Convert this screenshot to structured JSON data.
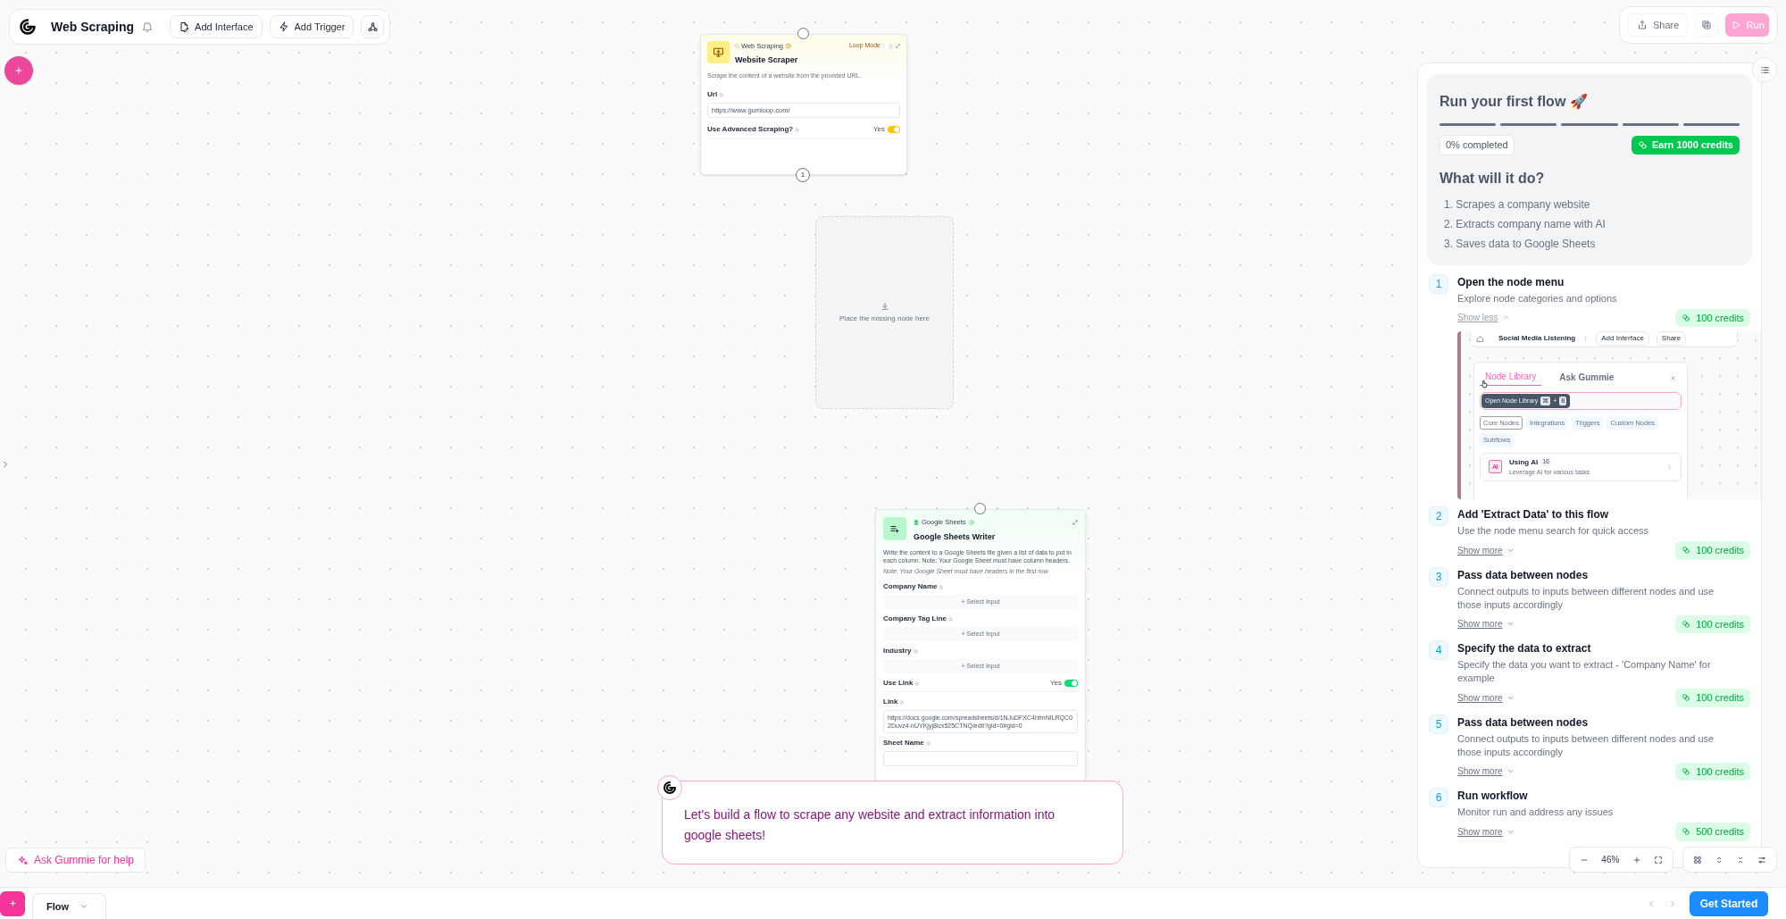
{
  "toolbar": {
    "title": "Web Scraping",
    "buttons": [
      {
        "kind": "interface",
        "label": "Add Interface"
      },
      {
        "kind": "trigger",
        "label": "Add Trigger"
      }
    ]
  },
  "scraper_node": {
    "category": "Web Scraping",
    "title": "Website Scraper",
    "loop_mode": {
      "label": "Loop Mode",
      "on": false
    },
    "description": "Scrape the content of a website from the provided URL.",
    "fields": [
      {
        "kind": "text",
        "label": "Url",
        "value": "https://www.gumloop.com/"
      },
      {
        "kind": "toggle",
        "label": "Use Advanced Scraping?",
        "value_label": "Yes",
        "on": true
      }
    ],
    "output_count": "1"
  },
  "placeholder": {
    "label": "Place the missing node here"
  },
  "sheets_node": {
    "category": "Google Sheets",
    "title": "Google Sheets Writer",
    "description": "Write the content to a Google Sheets file given a list of data to put in each column. Note: Your Google Sheet must have column headers.",
    "note": "Note: Your Google Sheet must have headers in the first row",
    "fields": [
      {
        "kind": "select",
        "label": "Company Name",
        "placeholder": "+ Select Input"
      },
      {
        "kind": "select",
        "label": "Company Tag Line",
        "placeholder": "+ Select Input"
      },
      {
        "kind": "select",
        "label": "Industry",
        "placeholder": "+ Select Input"
      },
      {
        "kind": "toggle",
        "label": "Use Link",
        "value_label": "Yes",
        "on": true
      },
      {
        "kind": "textarea",
        "label": "Link",
        "value": "https://docs.google.com/spreadsheets/d/1NJuDFXC4hfmNILRQC02Duvz4-nUYKjyj8icx525CTNQ/edit?gid=0#gid=0"
      },
      {
        "kind": "text",
        "label": "Sheet Name"
      }
    ]
  },
  "chat_bubble": {
    "message": "Let's build a flow to scrape any website and extract information into google sheets!"
  },
  "help_button": {
    "label": "Ask Gummie for help"
  },
  "top_actions": {
    "share": "Share",
    "run": {
      "label": "Run",
      "disabled": true
    }
  },
  "guide": {
    "title": "Run your first flow 🚀",
    "progress_segments": [
      {
        "done": false
      },
      {
        "done": false
      },
      {
        "done": false
      },
      {
        "done": false
      },
      {
        "done": false
      }
    ],
    "completed": "0% completed",
    "earn": "Earn 1000 credits",
    "subtitle": "What will it do?",
    "items": [
      "1. Scrapes a company website",
      "2. Extracts company name with AI",
      "3. Saves data to Google Sheets"
    ],
    "steps": [
      {
        "number": "1",
        "title": "Open the node menu",
        "description": "Explore node categories and options",
        "toggle": "Show less",
        "expanded": true,
        "credits": "100 credits"
      },
      {
        "number": "2",
        "title": "Add 'Extract Data' to this flow",
        "description": "Use the node menu search for quick access",
        "toggle": "Show more",
        "expanded": false,
        "credits": "100 credits"
      },
      {
        "number": "3",
        "title": "Pass data between nodes",
        "description": "Connect outputs to inputs between different nodes and use those inputs accordingly",
        "toggle": "Show more",
        "expanded": false,
        "credits": "100 credits"
      },
      {
        "number": "4",
        "title": "Specify the data to extract",
        "description": "Specify the data you want to extract - 'Company Name' for example",
        "toggle": "Show more",
        "expanded": false,
        "credits": "100 credits"
      },
      {
        "number": "5",
        "title": "Pass data between nodes",
        "description": "Connect outputs to inputs between different nodes and use those inputs accordingly",
        "toggle": "Show more",
        "expanded": false,
        "credits": "100 credits"
      },
      {
        "number": "6",
        "title": "Run workflow",
        "description": "Monitor run and address any issues",
        "toggle": "Show more",
        "expanded": false,
        "credits": "500 credits"
      }
    ],
    "preview": {
      "toolbar": {
        "title": "Social Media Listening",
        "buttons": [
          "Add Interface",
          "Share"
        ]
      },
      "tabs": [
        {
          "label": "Node Library",
          "selected": true
        },
        {
          "label": "Ask Gummie",
          "selected": false
        }
      ],
      "tooltip": {
        "label": "Open Node Library",
        "keys": [
          "⌘",
          "B"
        ],
        "joiner": "+"
      },
      "chips": [
        {
          "label": "Core Nodes",
          "selected": true
        },
        {
          "label": "Integrations",
          "selected": false
        },
        {
          "label": "Triggers",
          "selected": false
        },
        {
          "label": "Custom Nodes",
          "selected": false
        },
        {
          "label": "Subflows",
          "selected": false
        }
      ],
      "item": {
        "badge": "AI",
        "title": "Using AI",
        "count": "16",
        "description": "Leverage AI for various tasks"
      }
    }
  },
  "zoom": {
    "value": "46%"
  },
  "bottom_tabs": [
    {
      "label": "Flow",
      "selected": true
    }
  ],
  "get_started": "Get Started"
}
